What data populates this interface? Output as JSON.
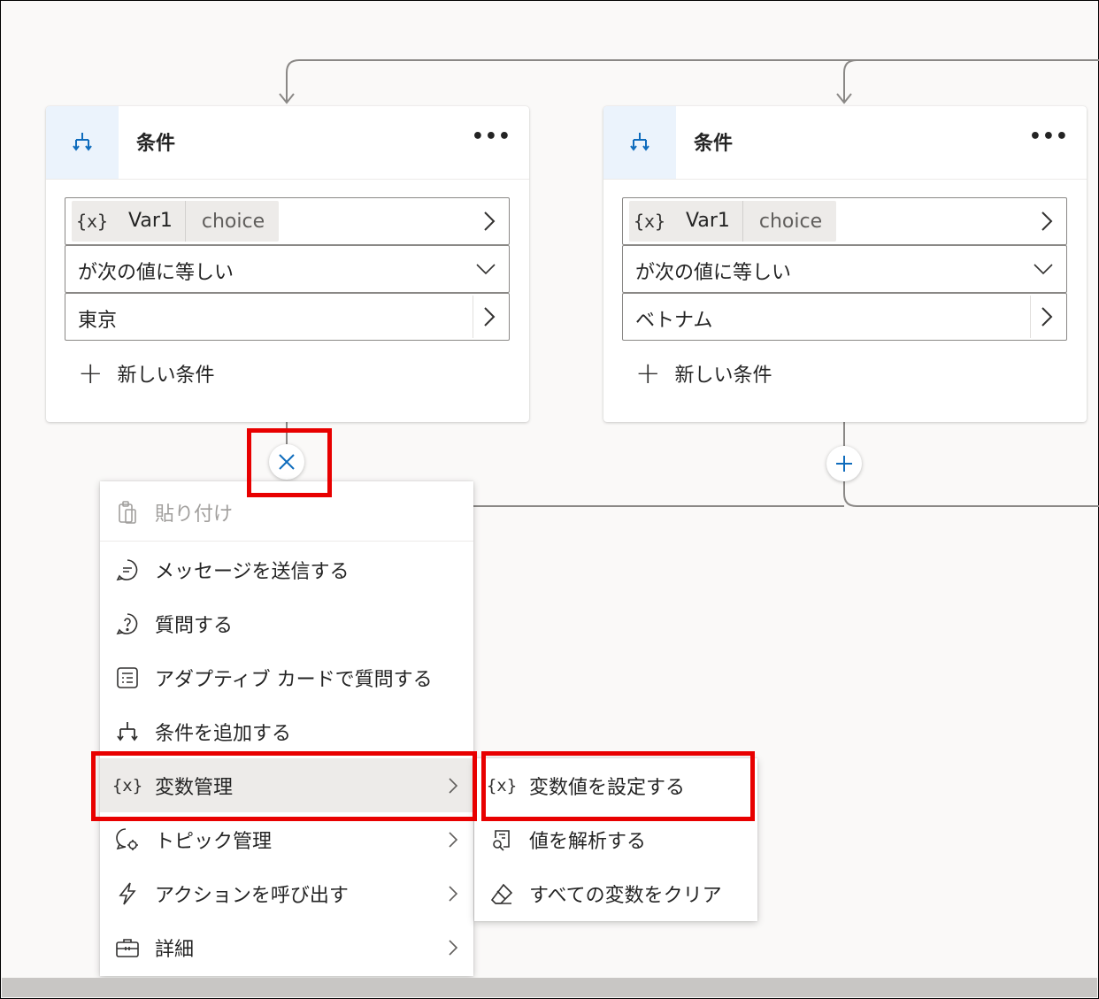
{
  "cards": [
    {
      "title": "条件",
      "more": "•••",
      "variable": {
        "icon": "{x}",
        "name": "Var1",
        "type": "choice"
      },
      "operator": "が次の値に等しい",
      "value": "東京",
      "add_condition": "新しい条件"
    },
    {
      "title": "条件",
      "more": "•••",
      "variable": {
        "icon": "{x}",
        "name": "Var1",
        "type": "choice"
      },
      "operator": "が次の値に等しい",
      "value": "ベトナム",
      "add_condition": "新しい条件"
    }
  ],
  "menu": {
    "items": [
      {
        "label": "貼り付け",
        "icon": "clipboard-icon",
        "disabled": true
      },
      {
        "label": "メッセージを送信する",
        "icon": "chat-icon"
      },
      {
        "label": "質問する",
        "icon": "question-icon"
      },
      {
        "label": "アダプティブ カードで質問する",
        "icon": "card-icon"
      },
      {
        "label": "条件を追加する",
        "icon": "branch-icon"
      },
      {
        "label": "変数管理",
        "icon": "variable-icon",
        "submenu": true,
        "active": true
      },
      {
        "label": "トピック管理",
        "icon": "topic-gear-icon",
        "submenu": true
      },
      {
        "label": "アクションを呼び出す",
        "icon": "lightning-icon",
        "submenu": true
      },
      {
        "label": "詳細",
        "icon": "toolbox-icon",
        "submenu": true
      }
    ]
  },
  "submenu": {
    "items": [
      {
        "label": "変数値を設定する",
        "icon": "variable-icon"
      },
      {
        "label": "値を解析する",
        "icon": "parse-value-icon"
      },
      {
        "label": "すべての変数をクリア",
        "icon": "eraser-icon"
      }
    ]
  },
  "colors": {
    "canvas": "#faf9f8",
    "accent_blue": "#0f6cbd",
    "icon_blue_bg": "#ebf3fc",
    "highlight_red": "#e80000",
    "connector": "#8a8886"
  }
}
